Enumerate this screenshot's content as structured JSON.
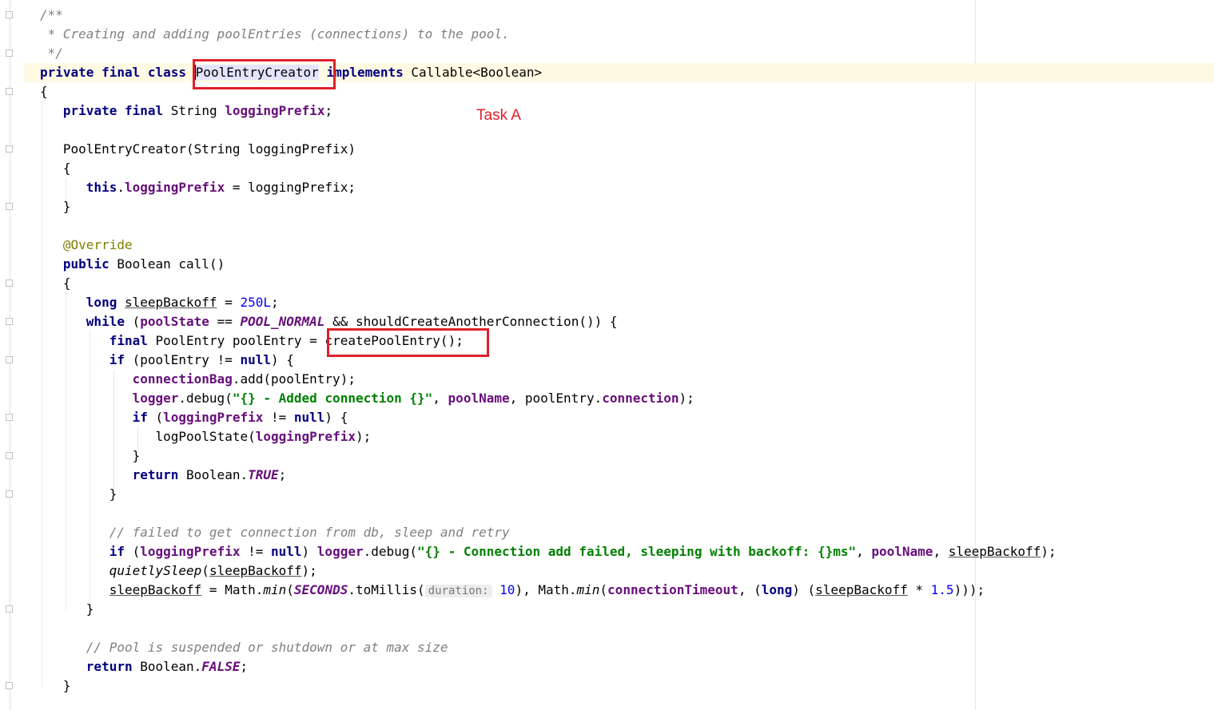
{
  "annotation": {
    "task_label": "Task A",
    "highlight_color": "#e0202a"
  },
  "colors": {
    "keyword": "#000080",
    "field": "#660e7a",
    "comment": "#808080",
    "string": "#008000",
    "number": "#0000ff",
    "annotation": "#808000",
    "current_line": "#fffae3"
  },
  "code": {
    "l1": "/**",
    "l2": " * Creating and adding poolEntries (connections) to the pool.",
    "l3": " */",
    "class_decl": {
      "kw": "private final class",
      "name": "PoolEntryCreator",
      "implements": "implements",
      "iface": "Callable<Boolean>"
    },
    "brace_open": "{",
    "brace_close": "}",
    "field_decl": {
      "kw": "private final",
      "type": "String",
      "name": "loggingPrefix",
      "end": ";"
    },
    "ctor_decl": "PoolEntryCreator(String loggingPrefix)",
    "ctor_body": {
      "kw": "this",
      "dot": ".",
      "field": "loggingPrefix",
      "rest": " = loggingPrefix;"
    },
    "override": "@Override",
    "call_decl": {
      "kw": "public",
      "rest": "Boolean call()"
    },
    "sleep_decl": {
      "kw": "long",
      "var": "sleepBackoff",
      "eq": " = ",
      "num": "250L",
      "end": ";"
    },
    "while_line": {
      "kw": "while",
      "open": " (",
      "field": "poolState",
      "op": " == ",
      "const": "POOL_NORMAL",
      "rest": " && shouldCreateAnotherConnection()) {"
    },
    "entry_line": {
      "kw": "final",
      "rest": "PoolEntry poolEntry = ",
      "call": "createPoolEntry();"
    },
    "if_entry": {
      "kw": "if",
      "mid": " (poolEntry != ",
      "kw2": "null",
      "end": ") {"
    },
    "bag_line": {
      "field": "connectionBag",
      "rest": ".add(poolEntry);"
    },
    "debug_line": {
      "field": "logger",
      "call": ".debug(",
      "str": "\"{} - Added connection {}\"",
      "comma": ", ",
      "field2": "poolName",
      "mid": ", poolEntry.",
      "field3": "connection",
      "end": ");"
    },
    "if_prefix": {
      "kw": "if",
      "open": " (",
      "field": "loggingPrefix",
      "mid": " != ",
      "kw2": "null",
      "end": ") {"
    },
    "log_state": {
      "call": "logPoolState(",
      "field": "loggingPrefix",
      "end": ");"
    },
    "return_true": {
      "kw": "return",
      "mid": " Boolean.",
      "const": "TRUE",
      "end": ";"
    },
    "comment_failed": "// failed to get connection from db, sleep and retry",
    "debug_failed": {
      "kw": "if",
      "open": " (",
      "field": "loggingPrefix",
      "mid": " != ",
      "kw2": "null",
      "close": ") ",
      "field2": "logger",
      "call": ".debug(",
      "str": "\"{} - Connection add failed, sleeping with backoff: {}ms\"",
      "comma": ", ",
      "field3": "poolName",
      "comma2": ", ",
      "var": "sleepBackoff",
      "end": ");"
    },
    "quiet_sleep": {
      "call": "quietlySleep",
      "open": "(",
      "var": "sleepBackoff",
      "end": ");"
    },
    "backoff_calc": {
      "var": "sleepBackoff",
      "eq": " = Math.",
      "min1": "min",
      "open1": "(",
      "const": "SECONDS",
      "millis": ".toMillis(",
      "hint": "duration:",
      "num1": "10",
      "mid": "), Math.",
      "min2": "min",
      "open2": "(",
      "field": "connectionTimeout",
      "mid2": ", (",
      "kw": "long",
      "mid3": ") (",
      "var2": "sleepBackoff",
      "op": " * ",
      "num2": "1.5",
      "end": ")));"
    },
    "comment_pool": "// Pool is suspended or shutdown or at max size",
    "return_false": {
      "kw": "return",
      "mid": " Boolean.",
      "const": "FALSE",
      "end": ";"
    }
  }
}
